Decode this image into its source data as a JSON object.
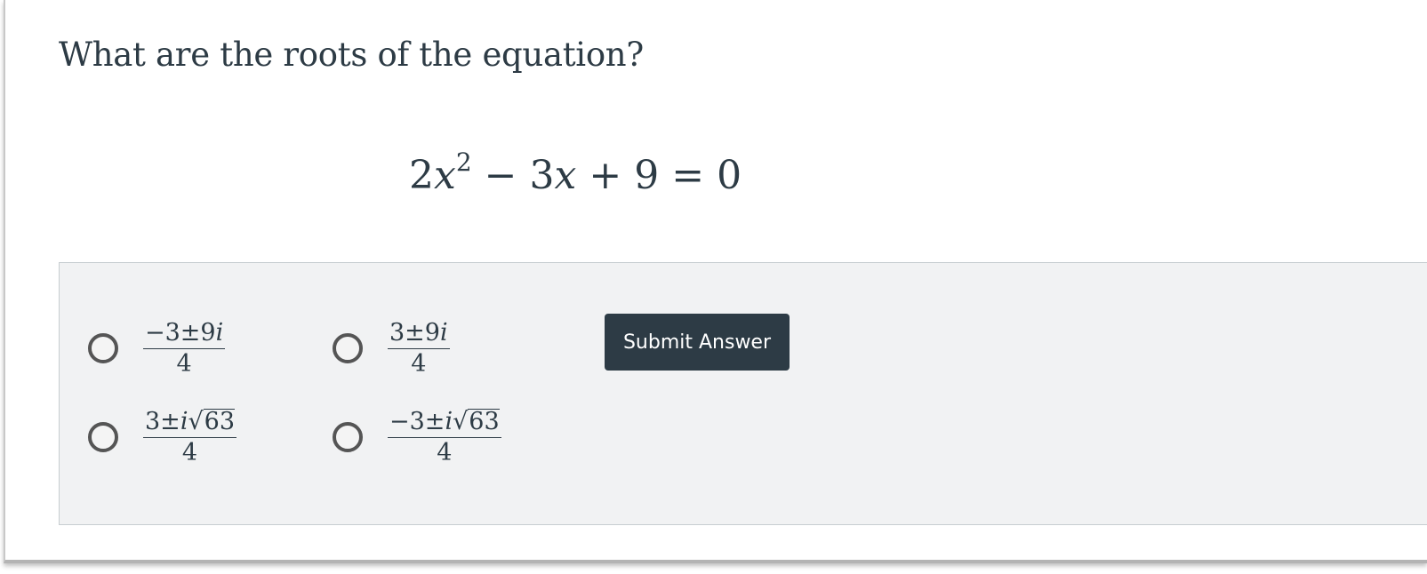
{
  "question": {
    "prompt": "What are the roots of the equation?"
  },
  "equation": {
    "coef_a": "2",
    "variable": "x",
    "exponent": "2",
    "op1": "−",
    "term2": "3",
    "op2": "+",
    "constant": "9",
    "equals": "=",
    "rhs": "0"
  },
  "options": [
    {
      "numerator_prefix": "−3±9",
      "imag": "i",
      "numerator_suffix": "",
      "radicand": "",
      "denominator": "4",
      "selected": false
    },
    {
      "numerator_prefix": "3±9",
      "imag": "i",
      "numerator_suffix": "",
      "radicand": "",
      "denominator": "4",
      "selected": false
    },
    {
      "numerator_prefix": "3±",
      "imag": "i",
      "radical_sign": "√",
      "radicand": "63",
      "denominator": "4",
      "selected": false
    },
    {
      "numerator_prefix": "−3±",
      "imag": "i",
      "radical_sign": "√",
      "radicand": "63",
      "denominator": "4",
      "selected": false
    }
  ],
  "submit": {
    "label": "Submit Answer"
  },
  "colors": {
    "text": "#2d3b45",
    "panel": "#f1f2f3",
    "button": "#2d3b45",
    "radio_border": "#555555"
  }
}
